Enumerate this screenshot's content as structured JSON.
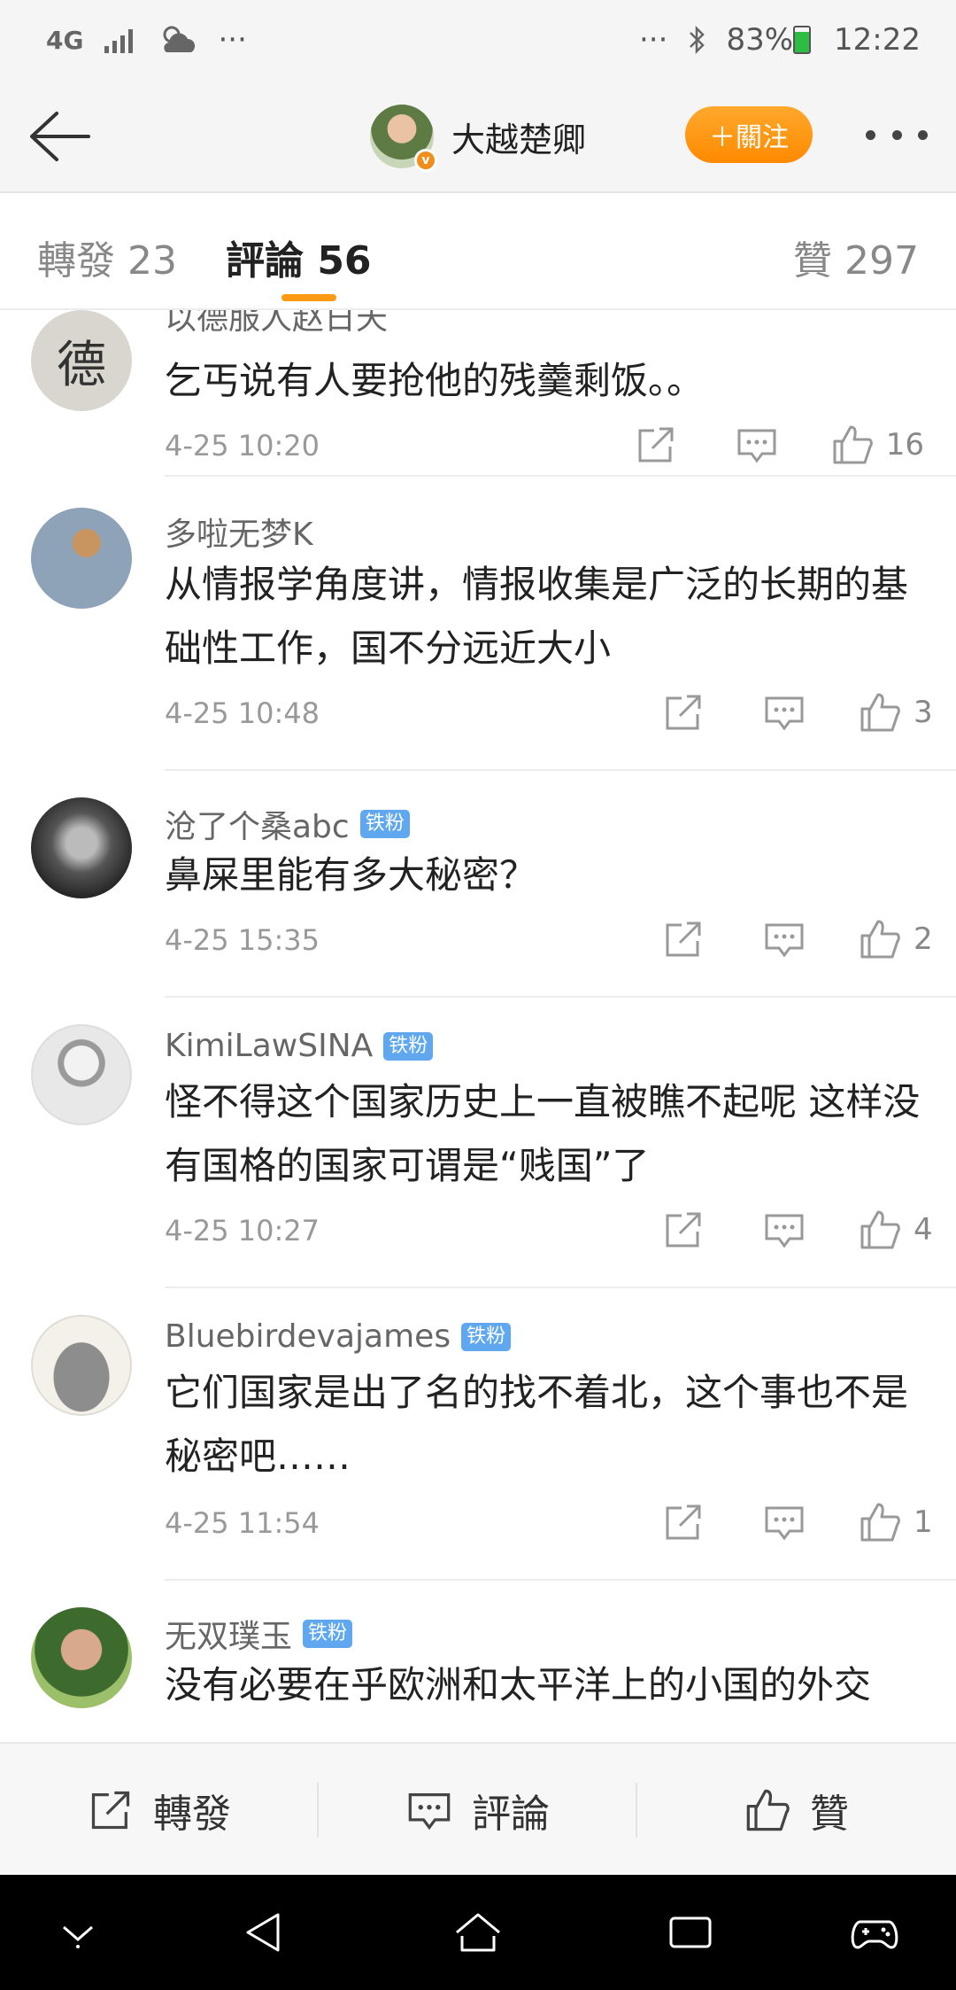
{
  "status_bar": {
    "network": "4G",
    "left_extra": "···",
    "right_extra": "···",
    "battery": "83%",
    "time": "12:22"
  },
  "header": {
    "username": "大越楚卿",
    "follow_label": "＋關注"
  },
  "tabs": {
    "reposts_label": "轉發 23",
    "comments_label": "評論 56",
    "likes_label": "贊 297"
  },
  "comments": [
    {
      "name": "以德服人赵日天",
      "badge": "",
      "text": "乞丐说有人要抢他的残羹剩饭。。",
      "time": "4-25 10:20",
      "likes": "16",
      "avatar_text": "德"
    },
    {
      "name": "多啦无梦K",
      "badge": "",
      "text": "从情报学角度讲，情报收集是广泛的长期的基础性工作，国不分远近大小",
      "time": "4-25 10:48",
      "likes": "3"
    },
    {
      "name": "沧了个桑abc",
      "badge": "铁粉",
      "text": "鼻屎里能有多大秘密？",
      "time": "4-25 15:35",
      "likes": "2"
    },
    {
      "name": "KimiLawSINA",
      "badge": "铁粉",
      "text": "怪不得这个国家历史上一直被瞧不起呢 这样没有国格的国家可谓是“贱国”了",
      "time": "4-25 10:27",
      "likes": "4"
    },
    {
      "name": "Bluebirdevajames",
      "badge": "铁粉",
      "text": "它们国家是出了名的找不着北，这个事也不是秘密吧……",
      "time": "4-25 11:54",
      "likes": "1"
    },
    {
      "name": "无双璞玉",
      "badge": "铁粉",
      "text": "没有必要在乎欧洲和太平洋上的小国的外交",
      "time": "",
      "likes": ""
    }
  ],
  "bottom_bar": {
    "repost_label": "轉發",
    "comment_label": "評論",
    "like_label": "贊"
  },
  "colors": {
    "accent": "#ff9a14",
    "badge": "#5fa8f0",
    "text": "#222222",
    "muted": "#999999"
  }
}
